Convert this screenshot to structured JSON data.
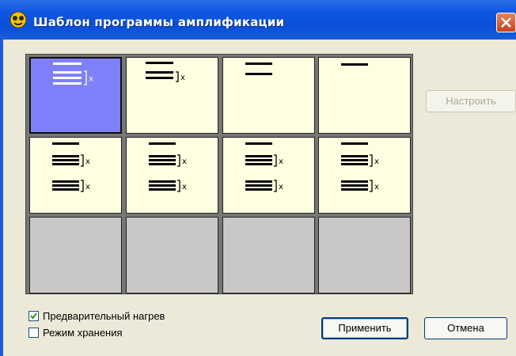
{
  "window": {
    "title": "Шаблон программы амплификации",
    "app_icon": "amplification-app-icon",
    "close_icon": "close-icon"
  },
  "template_grid": {
    "rows": [
      [
        {
          "state": "selected",
          "pattern": "hold-cycle"
        },
        {
          "state": "filled",
          "pattern": "cycle"
        },
        {
          "state": "filled",
          "pattern": "two-steps"
        },
        {
          "state": "filled",
          "pattern": "one-step"
        }
      ],
      [
        {
          "state": "filled",
          "pattern": "hold-two-cycles"
        },
        {
          "state": "filled",
          "pattern": "hold-two-cycles"
        },
        {
          "state": "filled",
          "pattern": "hold-two-cycles"
        },
        {
          "state": "filled",
          "pattern": "hold-two-cycles"
        }
      ],
      [
        {
          "state": "empty"
        },
        {
          "state": "empty"
        },
        {
          "state": "empty"
        },
        {
          "state": "empty"
        }
      ]
    ],
    "cycle_marker": "x"
  },
  "buttons": {
    "configure": "Настроить",
    "apply": "Применить",
    "cancel": "Отмена"
  },
  "options": {
    "preheat": {
      "label": "Предварительный нагрев",
      "checked": true
    },
    "storage_mode": {
      "label": "Режим хранения",
      "checked": false
    }
  },
  "colors": {
    "selected_cell": "#7f81fa",
    "filled_cell": "#fefee0",
    "empty_cell": "#c9c8c6",
    "title_bar": "#0a4fd8"
  }
}
